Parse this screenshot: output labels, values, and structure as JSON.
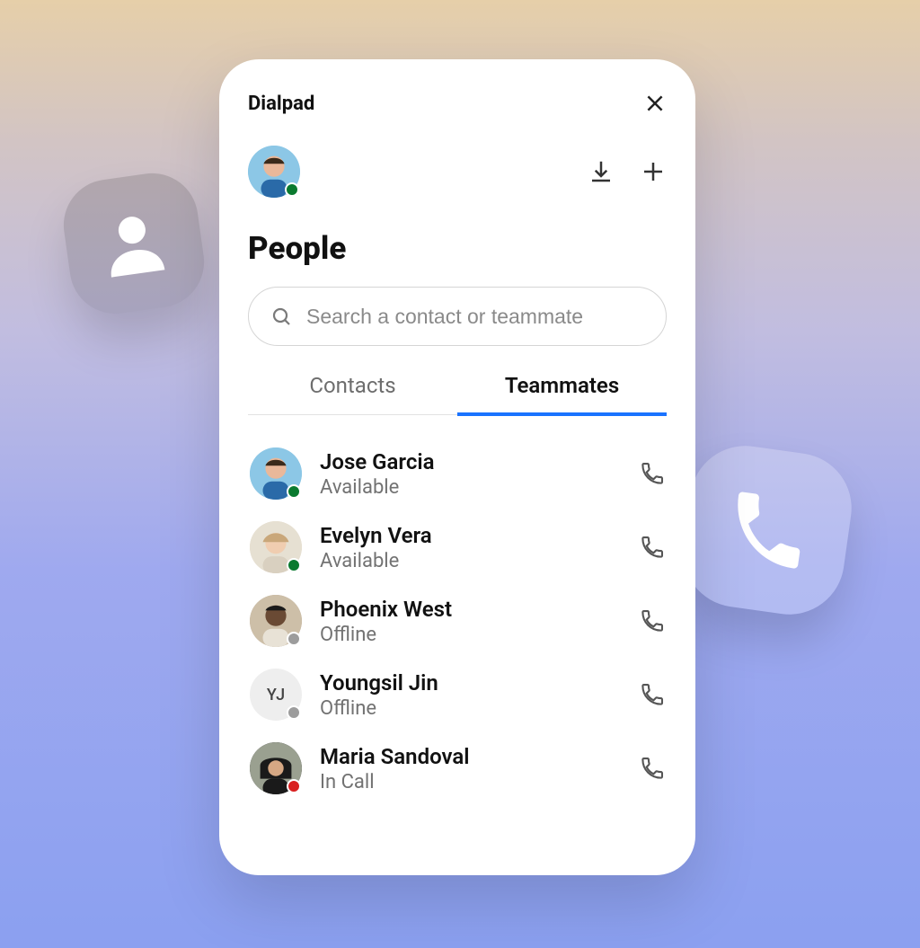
{
  "app": {
    "title": "Dialpad"
  },
  "page": {
    "title": "People",
    "search_placeholder": "Search a contact or teammate"
  },
  "tabs": [
    {
      "label": "Contacts",
      "active": false
    },
    {
      "label": "Teammates",
      "active": true
    }
  ],
  "current_user": {
    "status": "available",
    "avatar_bg": "#8cc7e6"
  },
  "status_colors": {
    "available": "#0a7a2f",
    "offline": "#9c9c9c",
    "in_call": "#d92020"
  },
  "teammates": [
    {
      "name": "Jose Garcia",
      "status_label": "Available",
      "status": "available",
      "avatar_bg": "#8cc7e6",
      "initials": ""
    },
    {
      "name": "Evelyn Vera",
      "status_label": "Available",
      "status": "available",
      "avatar_bg": "#e6d8c6",
      "initials": ""
    },
    {
      "name": "Phoenix West",
      "status_label": "Offline",
      "status": "offline",
      "avatar_bg": "#b9a58f",
      "initials": ""
    },
    {
      "name": "Youngsil Jin",
      "status_label": "Offline",
      "status": "offline",
      "avatar_bg": "#eeeeee",
      "initials": "YJ"
    },
    {
      "name": "Maria Sandoval",
      "status_label": "In Call",
      "status": "in_call",
      "avatar_bg": "#3a3a3a",
      "initials": ""
    }
  ],
  "icons": {
    "close": "close-icon",
    "download": "download-icon",
    "add": "plus-icon",
    "search": "search-icon",
    "call": "phone-icon",
    "person": "person-icon"
  }
}
